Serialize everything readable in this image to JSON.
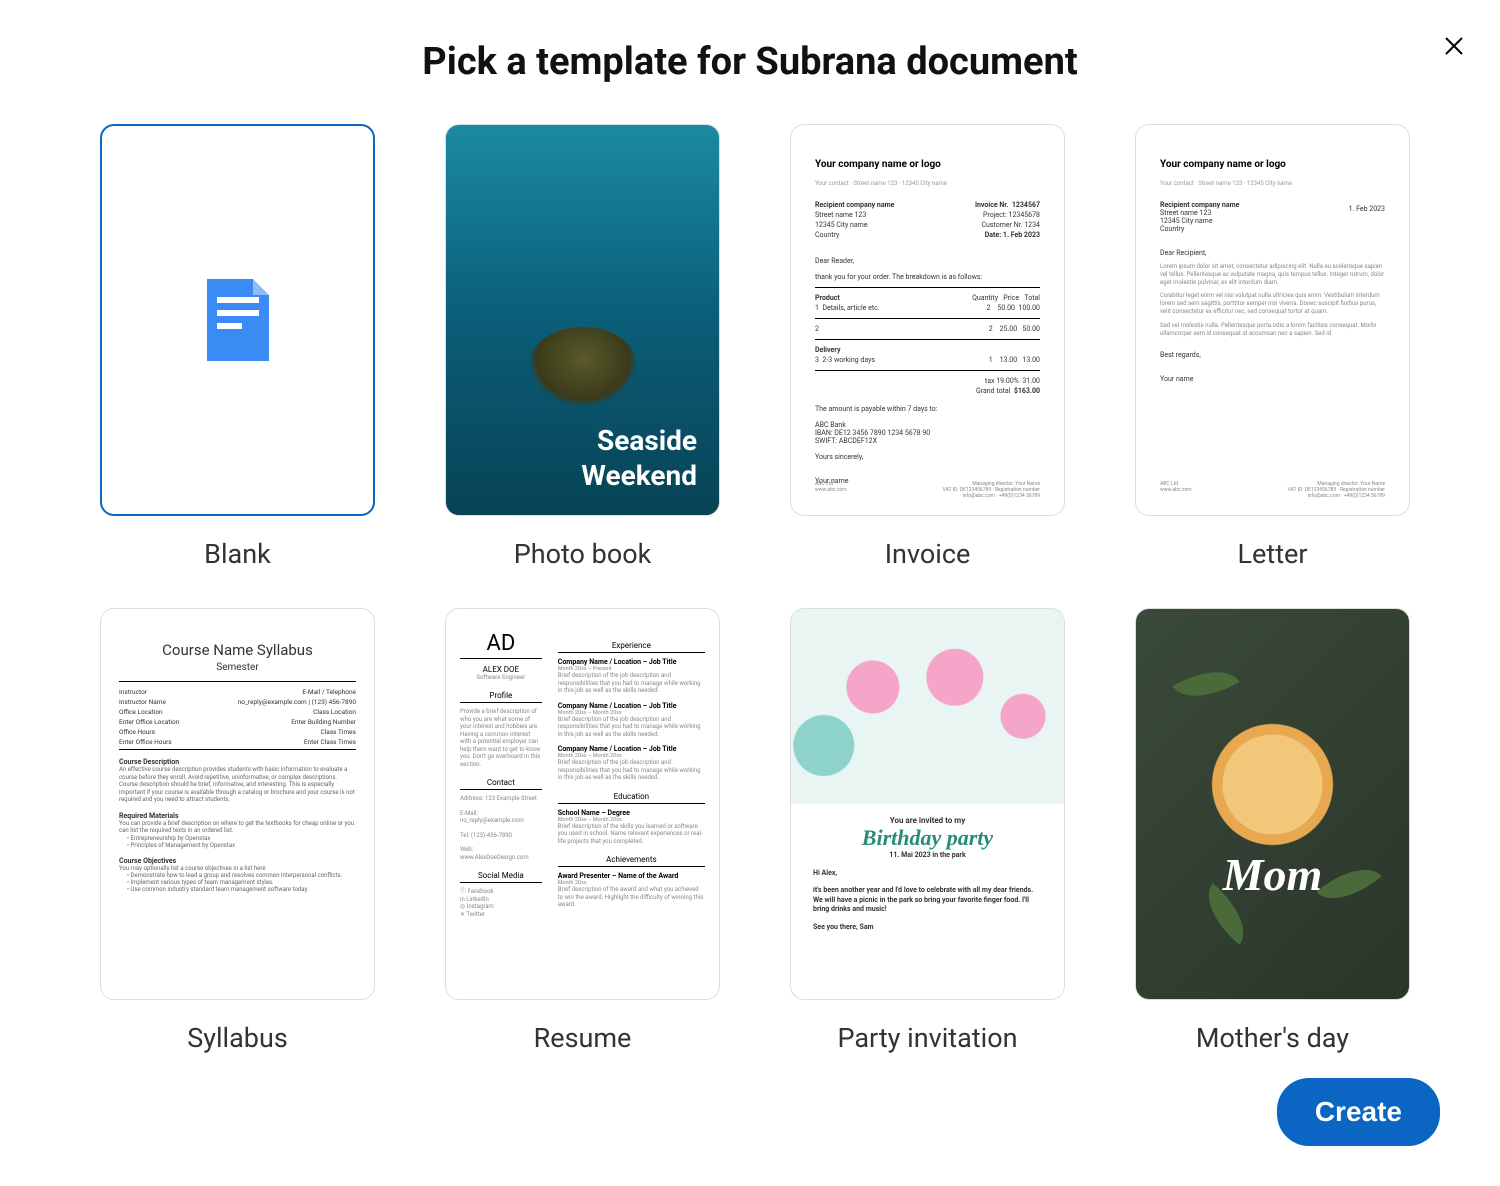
{
  "title": "Pick a template for Subrana document",
  "create_button": "Create",
  "templates": [
    {
      "label": "Blank"
    },
    {
      "label": "Photo book",
      "overlay_line1": "Seaside",
      "overlay_line2": "Weekend"
    },
    {
      "label": "Invoice",
      "header": "Your company name or logo",
      "recipient_label": "Recipient company name",
      "addr1": "Street name 123",
      "addr2": "12345 City name",
      "addr3": "Country",
      "invoice_no_label": "Invoice Nr.",
      "invoice_no": "1234567",
      "project_label": "Project:",
      "project": "12345678",
      "customer_label": "Customer Nr.",
      "customer": "1234",
      "date_label": "Date:",
      "date": "1. Feb 2023",
      "greeting": "Dear Reader,",
      "intro": "thank you for your order. The breakdown is as follows:",
      "col_product": "Product",
      "col_qty": "Quantity",
      "col_price": "Price",
      "col_total": "Total",
      "row1_name": "Details, article etc.",
      "row1_qty": "2",
      "row1_price": "50.00",
      "row1_total": "100.00",
      "row2_qty": "2",
      "row2_price": "25.00",
      "row2_total": "50.00",
      "row3_label": "Delivery",
      "row3_name": "2-3 working days",
      "row3_qty": "1",
      "row3_price": "13.00",
      "row3_total": "13.00",
      "tax_label": "tax 19.00%",
      "tax_val": "31.00",
      "grand_label": "Grand total",
      "grand_val": "$163.00",
      "payable": "The amount is payable within 7 days to:",
      "bank1": "ABC Bank",
      "bank2": "IBAN: DE12 3456 7890 1234 5678 90",
      "bank3": "SWIFT: ABCDEF12X",
      "signoff": "Yours sincerely,",
      "yourname": "Your name"
    },
    {
      "label": "Letter",
      "header": "Your company name or logo",
      "date": "1. Feb 2023",
      "recipient_label": "Recipient company name",
      "addr1": "Street name 123",
      "addr2": "12345 City name",
      "addr3": "Country",
      "greeting": "Dear Recipient,",
      "para1": "Lorem ipsum dolor sit amet, consectetur adipiscing elit. Nulla eu scelerisque sapien vel tellus. Pellentesque ac vulputate magna, quis tempus tellus. Integer rutrum, dolor eget molestie pulvinar, ex elit interdum diam.",
      "para2": "Curabitur leget enim vel nisi volutpat nulla ultricies quis enim. Vestibulum interdum lorem sed sem sagittis, porttitor semper nisi viverra. Donec suscipit finibus purus, velit consectetur ex efficitur nec, sed consequat tortor at quam.",
      "para3": "Sed vel molestie nulla. Pellentesque porta odio a lorem facilisis consequat. Morbi ullamcorper sem id consequat id accumsan nec a sapien. Sed id.",
      "signoff": "Best regards,",
      "yourname": "Your name"
    },
    {
      "label": "Syllabus",
      "title": "Course Name Syllabus",
      "subtitle": "Semester",
      "instructor_l": "Instructor",
      "instructor_r": "E-Mail / Telephone",
      "name_l": "Instructor Name",
      "name_r": "no_reply@example.com | (123) 456-7890",
      "office_l": "Office Location",
      "office_r": "Class Location",
      "officeval_l": "Enter Office Location",
      "officeval_r": "Enter Building Number",
      "hours_l": "Office Hours",
      "hours_r": "Class Times",
      "hoursval_l": "Enter Office Hours",
      "hoursval_r": "Enter Class Times",
      "desc_h": "Course Description",
      "desc_t": "An effective course description provides students with basic information to evaluate a course before they enroll. Avoid repetitive, uninformative, or complex descriptions. Course description should be brief, informative, and interesting. This is especially important if your course is available through a catalog or brochure and your course is not required and you need to attract students.",
      "mat_h": "Required Materials",
      "mat_t": "You can provide a brief description on where to get the textbooks for cheap online or you can list the required texts in an ordered list.",
      "mat_li1": "Entrepreneurship by Openstax",
      "mat_li2": "Principles of Management by Openstax",
      "obj_h": "Course Objectives",
      "obj_t": "You may optionally list a course objectives in a list here",
      "obj_li1": "Demonstrate how to lead a group and resolves common interpersonal conflicts.",
      "obj_li2": "Implement various types of team management styles.",
      "obj_li3": "Use common industry standard team management software today."
    },
    {
      "label": "Resume",
      "initials": "AD",
      "name": "ALEX DOE",
      "role": "Software Engineer",
      "profile_h": "Profile",
      "profile_t": "Provide a brief description of who you are what some of your interest and hobbies are. Having a common interest with a potential employer can help them want to get to know you. Don't go overboard in this section.",
      "contact_h": "Contact",
      "addr": "Address: 123 Example Street",
      "email": "E-Mail: no_reply@example.com",
      "tel": "Tel: (123)-456-7890",
      "web": "Web: www.AlexDoeDesign.com",
      "social_h": "Social Media",
      "s1": "Facebook",
      "s2": "LinkedIn",
      "s3": "Instagram",
      "s4": "Twitter",
      "exp_h": "Experience",
      "job_t": "Company Name / Location – Job Title",
      "job_d": "Month 20xx – Present",
      "job_txt": "Brief description of the job description and responsibilities that you had to manage while working in this job as well as the skills needed.",
      "edu_h": "Education",
      "edu_t": "School Name – Degree",
      "edu_txt": "Brief description of the skills you learned or software you used in school. Name relevant experiences or real-life projects that you completed.",
      "ach_h": "Achievements",
      "ach_t": "Award Presenter – Name of the Award",
      "ach_txt": "Brief description of the award and what you achieved to win the award. Highlight the difficulty of winning this award."
    },
    {
      "label": "Party invitation",
      "invited": "You are invited to my",
      "title": "Birthday party",
      "date": "11. Mai 2023 in the park",
      "greet": "Hi Alex,",
      "body": "it's been another year and I'd love to celebrate with all my dear friends. We will have a picnic in the park so bring your favorite finger food. I'll bring drinks and music!",
      "sign": "See you there, Sam"
    },
    {
      "label": "Mother's day",
      "text": "Mom"
    }
  ]
}
